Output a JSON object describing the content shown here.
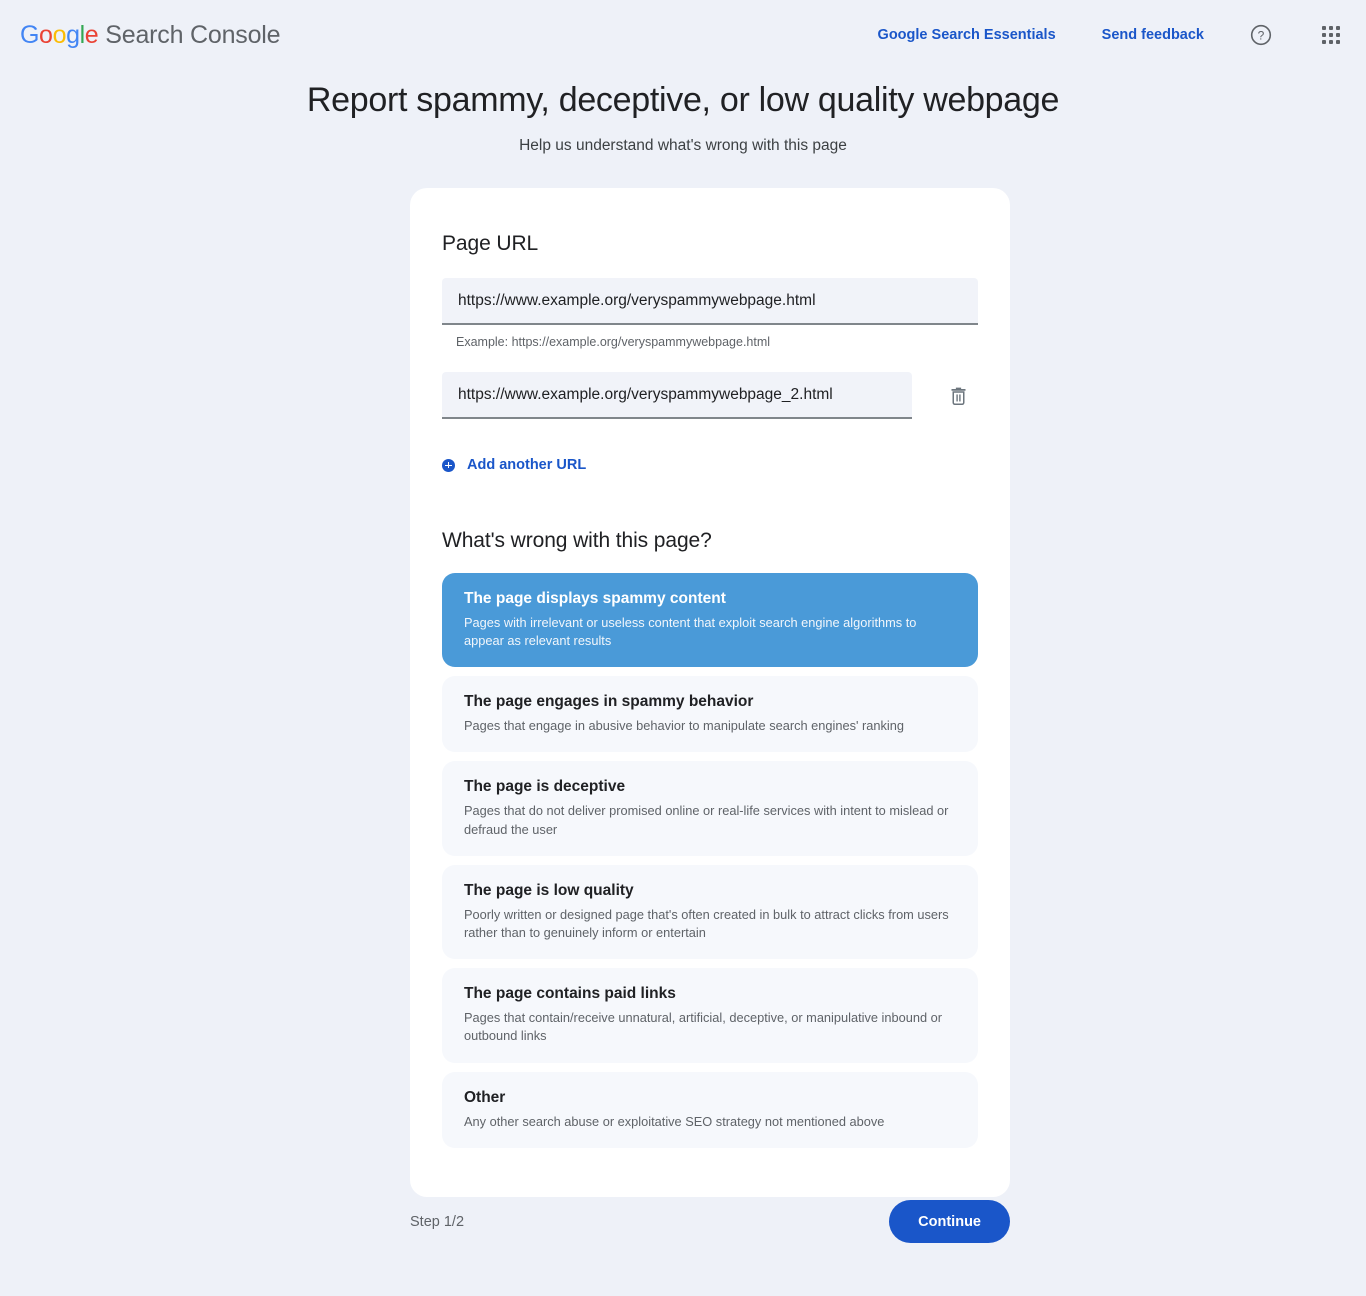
{
  "header": {
    "brand_google": "Google",
    "brand_product": "Search Console",
    "links": [
      {
        "label": "Google Search Essentials",
        "name": "google-search-essentials-link"
      },
      {
        "label": "Send feedback",
        "name": "send-feedback-link"
      }
    ],
    "help_icon": "help-circle-icon",
    "apps_icon": "apps-grid-icon",
    "link_color": "#1a56c9"
  },
  "page": {
    "title": "Report spammy, deceptive, or low quality webpage",
    "subtitle": "Help us understand what's wrong with this page"
  },
  "url_section": {
    "title": "Page URL",
    "fields": [
      {
        "value": "https://www.example.org/veryspammywebpage.html",
        "placeholder": "https://example.org/veryspammywebpage.html",
        "hint": "Example: https://example.org/veryspammywebpage.html",
        "deletable": false
      },
      {
        "value": "https://www.example.org/veryspammywebpage_2.html",
        "placeholder": "https://example.org/veryspammywebpage.html",
        "hint": "",
        "deletable": true,
        "delete_icon": "trash-icon"
      }
    ],
    "add_another": {
      "label": "Add another URL",
      "icon": "plus-circle-icon"
    }
  },
  "question_section": {
    "title": "What's wrong with this page?",
    "selected_index": 0,
    "selected_color": "#4a9ad8",
    "options": [
      {
        "title": "The page displays spammy content",
        "description": "Pages with irrelevant or useless content that exploit search engine algorithms to appear as relevant results",
        "selected": true
      },
      {
        "title": "The page engages in spammy behavior",
        "description": "Pages that engage in abusive behavior to manipulate search engines' ranking",
        "selected": false
      },
      {
        "title": "The page is deceptive",
        "description": "Pages that do not deliver promised online or real-life services with intent to mislead or defraud the user",
        "selected": false
      },
      {
        "title": "The page is low quality",
        "description": "Poorly written or designed page that's often created in bulk to attract clicks from users rather than to genuinely inform or entertain",
        "selected": false
      },
      {
        "title": "The page contains paid links",
        "description": "Pages that contain/receive unnatural, artificial, deceptive, or manipulative inbound or outbound links",
        "selected": false
      },
      {
        "title": "Other",
        "description": "Any other search abuse or exploitative SEO strategy not mentioned above",
        "selected": false
      }
    ]
  },
  "footer": {
    "step": "Step 1/2",
    "continue_label": "Continue",
    "continue_color": "#1a56c9"
  }
}
